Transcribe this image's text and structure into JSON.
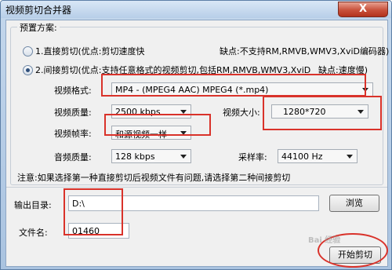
{
  "window": {
    "title": "视频剪切合并器",
    "close_label": "X"
  },
  "preset": {
    "legend": "预置方案:",
    "option1": {
      "label": "1.直接剪切(优点:剪切速度快",
      "drawback": "缺点:不支持RM,RMVB,WMV3,XviD编码器)"
    },
    "option2": {
      "label": "2.间接剪切(优点:支持任意格式的视频剪切,包括RM,RMVB,WMV3,XviD",
      "drawback": "缺点:速度慢)"
    }
  },
  "settings": {
    "format_label": "视频格式:",
    "format_value": "MP4 - (MPEG4 AAC) MPEG4 (*.mp4)",
    "quality_label": "视频质量:",
    "quality_value": "2500 kbps",
    "size_label": "视频大小:",
    "size_value": "1280*720",
    "framerate_label": "视频帧率:",
    "framerate_value": "和源视频一样",
    "audio_label": "音频质量:",
    "audio_value": "128 kbps",
    "samplerate_label": "采样率:",
    "samplerate_value": "44100 Hz"
  },
  "note": "注意:如果选择第一种直接剪切后视频文件有问题,请选择第二种间接剪切",
  "output": {
    "dir_label": "输出目录:",
    "dir_value": "D:\\",
    "browse_label": "浏览",
    "filename_label": "文件名:",
    "filename_value": "01460",
    "start_label": "开始剪切"
  },
  "watermark": "Bai 经验",
  "colors": {
    "highlight": "#d9322a",
    "title_bar": "#b7cee8",
    "close": "#c8513b"
  }
}
